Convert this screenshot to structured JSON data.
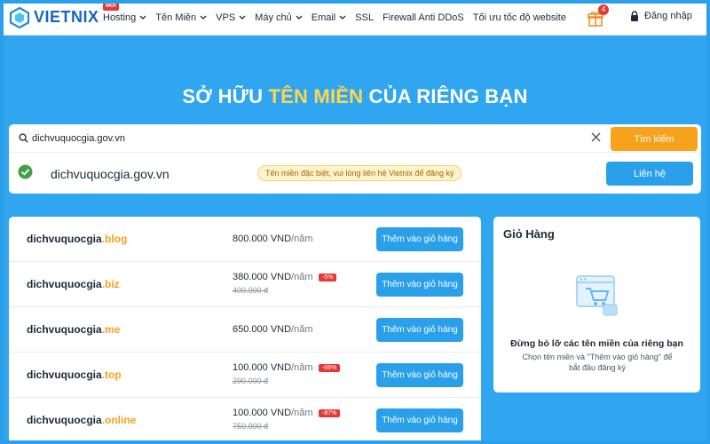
{
  "brand": {
    "name": "VIETNIX",
    "accent": "#2aa0ea",
    "orange": "#f7a21b"
  },
  "nav": {
    "new_badge": "MỚI",
    "items": [
      {
        "label": "Hosting",
        "dropdown": true
      },
      {
        "label": "Tên Miền",
        "dropdown": true
      },
      {
        "label": "VPS",
        "dropdown": true
      },
      {
        "label": "Máy chủ",
        "dropdown": true
      },
      {
        "label": "Email",
        "dropdown": true
      },
      {
        "label": "SSL",
        "dropdown": false
      },
      {
        "label": "Firewall Anti DDoS",
        "dropdown": false
      },
      {
        "label": "Tối ưu tốc độ website",
        "dropdown": false
      }
    ],
    "gift_count": "4",
    "login_label": "Đăng nhập"
  },
  "hero": {
    "title_part1": "SỞ HỮU ",
    "title_highlight": "TÊN MIỀN",
    "title_part2": " CỦA RIÊNG BẠN"
  },
  "search": {
    "value": "dichvuquocgia.gov.vn",
    "button_label": "Tìm kiếm",
    "result_domain": "dichvuquocgia.gov.vn",
    "result_note": "Tên miền đặc biệt, vui lòng liên hệ Vietnix để đăng ký",
    "contact_label": "Liên hệ"
  },
  "domains": [
    {
      "base": "dichvuquocgia",
      "ext": ".blog",
      "price": "800.000 VND",
      "unit": "/năm",
      "old_price": "",
      "discount": ""
    },
    {
      "base": "dichvuquocgia",
      "ext": ".biz",
      "price": "380.000 VND",
      "unit": "/năm",
      "old_price": "400.000 đ",
      "discount": "-5%"
    },
    {
      "base": "dichvuquocgia",
      "ext": ".me",
      "price": "650.000 VND",
      "unit": "/năm",
      "old_price": "",
      "discount": ""
    },
    {
      "base": "dichvuquocgia",
      "ext": ".top",
      "price": "100.000 VND",
      "unit": "/năm",
      "old_price": "290.000 đ",
      "discount": "-66%"
    },
    {
      "base": "dichvuquocgia",
      "ext": ".online",
      "price": "100.000 VND",
      "unit": "/năm",
      "old_price": "750.000 đ",
      "discount": "-87%"
    }
  ],
  "add_to_cart_label": "Thêm vào giỏ hàng",
  "cart": {
    "title": "Giỏ Hàng",
    "empty_title": "Đừng bỏ lỡ các tên miền của riêng bạn",
    "empty_hint": "Chọn tên miền và \"Thêm vào giỏ hàng\" để bắt đầu đăng ký"
  }
}
